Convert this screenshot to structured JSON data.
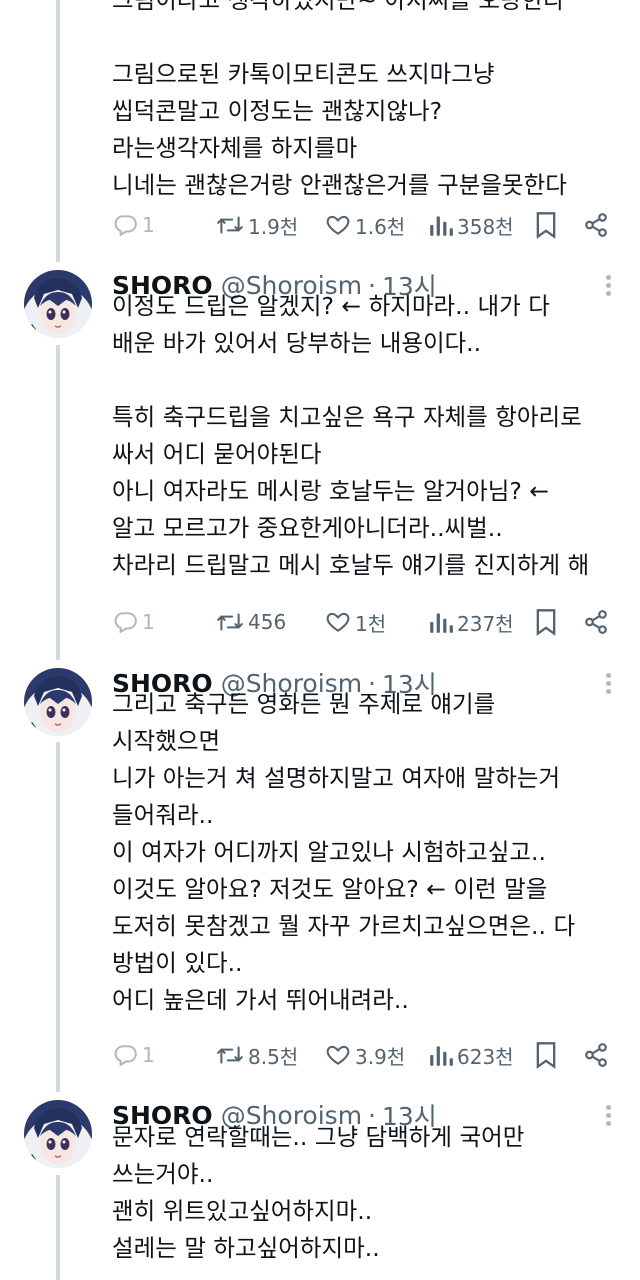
{
  "tweets": [
    {
      "is_continuation": true,
      "lines": [
        "그림이라고 생각하였지만~ 아저씨를 오랑한라",
        "",
        "그림으로된 카톡이모티콘도 쓰지마그냥",
        "씹덕콘말고 이정도는 괜찮지않나?",
        "라는생각자체를 하지를마",
        "니네는 괜찮은거랑 안괜찮은거를 구분을못한다"
      ],
      "stats": {
        "replies": "1",
        "retweets": "1.9천",
        "likes": "1.6천",
        "views": "358천"
      }
    },
    {
      "author": {
        "name": "SHORO",
        "handle": "@Shoroism",
        "time": "13시"
      },
      "lines": [
        "이정도 드립은 알겠지? ← 하지마라.. 내가 다",
        "배운 바가 있어서 당부하는 내용이다..",
        "",
        "특히 축구드립을 치고싶은 욕구 자체를 항아리로",
        "싸서 어디 묻어야된다",
        "아니 여자라도 메시랑 호날두는 알거아님? ←",
        "알고 모르고가 중요한게아니더라..씨벌..",
        "차라리 드립말고 메시 호날두 얘기를 진지하게 해"
      ],
      "stats": {
        "replies": "1",
        "retweets": "456",
        "likes": "1천",
        "views": "237천"
      }
    },
    {
      "author": {
        "name": "SHORO",
        "handle": "@Shoroism",
        "time": "13시"
      },
      "lines": [
        "그리고 축구든 영화든 뭔 주제로 얘기를",
        "시작했으면",
        "니가 아는거 쳐 설명하지말고 여자애 말하는거",
        "들어줘라..",
        "이 여자가 어디까지 알고있나 시험하고싶고..",
        "이것도 알아요? 저것도 알아요? ← 이런 말을",
        "도저히 못참겠고 뭘 자꾸 가르치고싶으면은.. 다",
        "방법이 있다..",
        "어디 높은데 가서 뛰어내려라.."
      ],
      "stats": {
        "replies": "1",
        "retweets": "8.5천",
        "likes": "3.9천",
        "views": "623천"
      }
    },
    {
      "author": {
        "name": "SHORO",
        "handle": "@Shoroism",
        "time": "13시"
      },
      "lines": [
        "문자로 연락할때는.. 그냥 담백하게 국어만",
        "쓰는거야..",
        "괜히 위트있고싶어하지마..",
        "설레는 말 하고싶어하지마.."
      ]
    }
  ],
  "colors": {
    "text": "#0f1419",
    "muted": "#536471",
    "thread_line": "#cfd9de",
    "icon": "#536471"
  },
  "icons": [
    "reply-icon",
    "retweet-icon",
    "like-icon",
    "views-icon",
    "bookmark-icon",
    "share-icon",
    "more-icon"
  ]
}
